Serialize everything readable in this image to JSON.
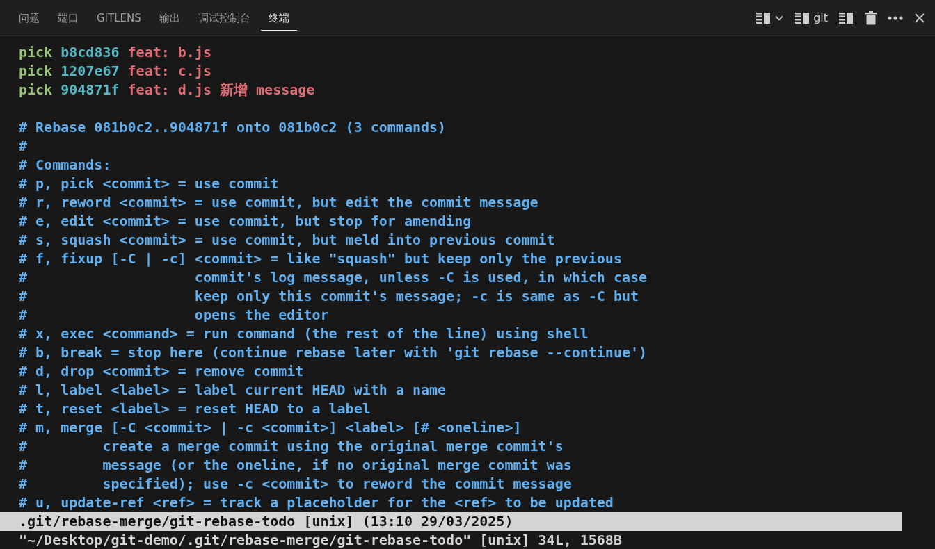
{
  "tabs": [
    {
      "label": "问题",
      "selected": false
    },
    {
      "label": "端口",
      "selected": false
    },
    {
      "label": "GITLENS",
      "selected": false
    },
    {
      "label": "输出",
      "selected": false
    },
    {
      "label": "调试控制台",
      "selected": false
    },
    {
      "label": "终端",
      "selected": true
    }
  ],
  "toolbar": {
    "terminal_name": "git"
  },
  "lines": [
    {
      "kind": "todo",
      "command": "pick",
      "hash": "b8cd836",
      "message": "feat: b.js"
    },
    {
      "kind": "todo",
      "command": "pick",
      "hash": "1207e67",
      "message": "feat: c.js"
    },
    {
      "kind": "todo",
      "command": "pick",
      "hash": "904871f",
      "message": "feat: d.js 新增 message"
    },
    {
      "kind": "blank"
    },
    {
      "kind": "comment",
      "text": "# Rebase 081b0c2..904871f onto 081b0c2 (3 commands)"
    },
    {
      "kind": "comment",
      "text": "#"
    },
    {
      "kind": "comment",
      "text": "# Commands:"
    },
    {
      "kind": "comment",
      "text": "# p, pick <commit> = use commit"
    },
    {
      "kind": "comment",
      "text": "# r, reword <commit> = use commit, but edit the commit message"
    },
    {
      "kind": "comment",
      "text": "# e, edit <commit> = use commit, but stop for amending"
    },
    {
      "kind": "comment",
      "text": "# s, squash <commit> = use commit, but meld into previous commit"
    },
    {
      "kind": "comment",
      "text": "# f, fixup [-C | -c] <commit> = like \"squash\" but keep only the previous"
    },
    {
      "kind": "comment",
      "text": "#                    commit's log message, unless -C is used, in which case"
    },
    {
      "kind": "comment",
      "text": "#                    keep only this commit's message; -c is same as -C but"
    },
    {
      "kind": "comment",
      "text": "#                    opens the editor"
    },
    {
      "kind": "comment",
      "text": "# x, exec <command> = run command (the rest of the line) using shell"
    },
    {
      "kind": "comment",
      "text": "# b, break = stop here (continue rebase later with 'git rebase --continue')"
    },
    {
      "kind": "comment",
      "text": "# d, drop <commit> = remove commit"
    },
    {
      "kind": "comment",
      "text": "# l, label <label> = label current HEAD with a name"
    },
    {
      "kind": "comment",
      "text": "# t, reset <label> = reset HEAD to a label"
    },
    {
      "kind": "comment",
      "text": "# m, merge [-C <commit> | -c <commit>] <label> [# <oneline>]"
    },
    {
      "kind": "comment",
      "text": "#         create a merge commit using the original merge commit's"
    },
    {
      "kind": "comment",
      "text": "#         message (or the oneline, if no original merge commit was"
    },
    {
      "kind": "comment",
      "text": "#         specified); use -c <commit> to reword the commit message"
    },
    {
      "kind": "comment",
      "text": "# u, update-ref <ref> = track a placeholder for the <ref> to be updated"
    }
  ],
  "status_line": ".git/rebase-merge/git-rebase-todo [unix] (13:10 29/03/2025)",
  "message_line": "\"~/Desktop/git-demo/.git/rebase-merge/git-rebase-todo\" [unix] 34L, 1568B"
}
